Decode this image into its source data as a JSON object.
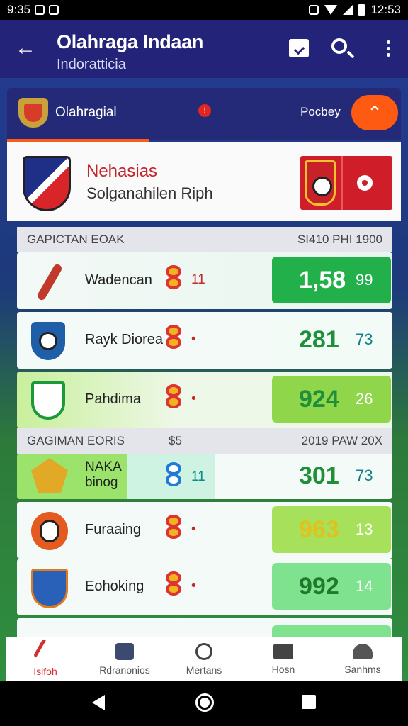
{
  "status_bar": {
    "time_left": "9:35",
    "time_right": "12:53"
  },
  "app_bar": {
    "title": "Olahraga Indaan",
    "subtitle": "Indoratticia"
  },
  "league": {
    "name": "Olahragial",
    "sport": "Pocbey",
    "alert": "!"
  },
  "featured": {
    "name": "Nehasias",
    "subtitle": "Solganahilen Riph"
  },
  "section1": {
    "left": "GAPICTAN EOAK",
    "right": "SI410 PHI 1900"
  },
  "section2": {
    "left": "GAGIMAN EORIS",
    "mid": "$5",
    "right": "2019 PAW 20X"
  },
  "rows": [
    {
      "name": "Wadencan",
      "small": "11",
      "score": "1,58",
      "score2": "99",
      "box_color": "#22b04a",
      "light": true,
      "crest": "bird"
    },
    {
      "name": "Rayk Diorea",
      "small": "•",
      "score": "281",
      "score2": "73",
      "box_color": "#f2fbf5",
      "light": false,
      "crest": "ball"
    },
    {
      "name": "Pahdima",
      "small": "•",
      "score": "924",
      "score2": "26",
      "box_color": "#8fd64a",
      "light": false,
      "crest": "green"
    },
    {
      "name": "NAKA\nbinog",
      "small": "11",
      "score": "301",
      "score2": "73",
      "box_color": "#ffffff",
      "light": false,
      "crest": "eagle",
      "blue": true
    },
    {
      "name": "Furaaing",
      "small": "•",
      "score": "963",
      "score2": "13",
      "box_color": "#a7e05a",
      "light": false,
      "crest": "lion"
    },
    {
      "name": "Eohoking",
      "small": "•",
      "score": "992",
      "score2": "14",
      "box_color": "#7ee28f",
      "light": false,
      "crest": "ship"
    }
  ],
  "bottom_nav": [
    {
      "label": "Isifoh",
      "icon": "kick-icon",
      "active": true
    },
    {
      "label": "Rdranonios",
      "icon": "news-icon",
      "active": false
    },
    {
      "label": "Mertans",
      "icon": "player-icon",
      "active": false
    },
    {
      "label": "Hosn",
      "icon": "tv-icon",
      "active": false
    },
    {
      "label": "Sanhms",
      "icon": "people-icon",
      "active": false
    }
  ]
}
